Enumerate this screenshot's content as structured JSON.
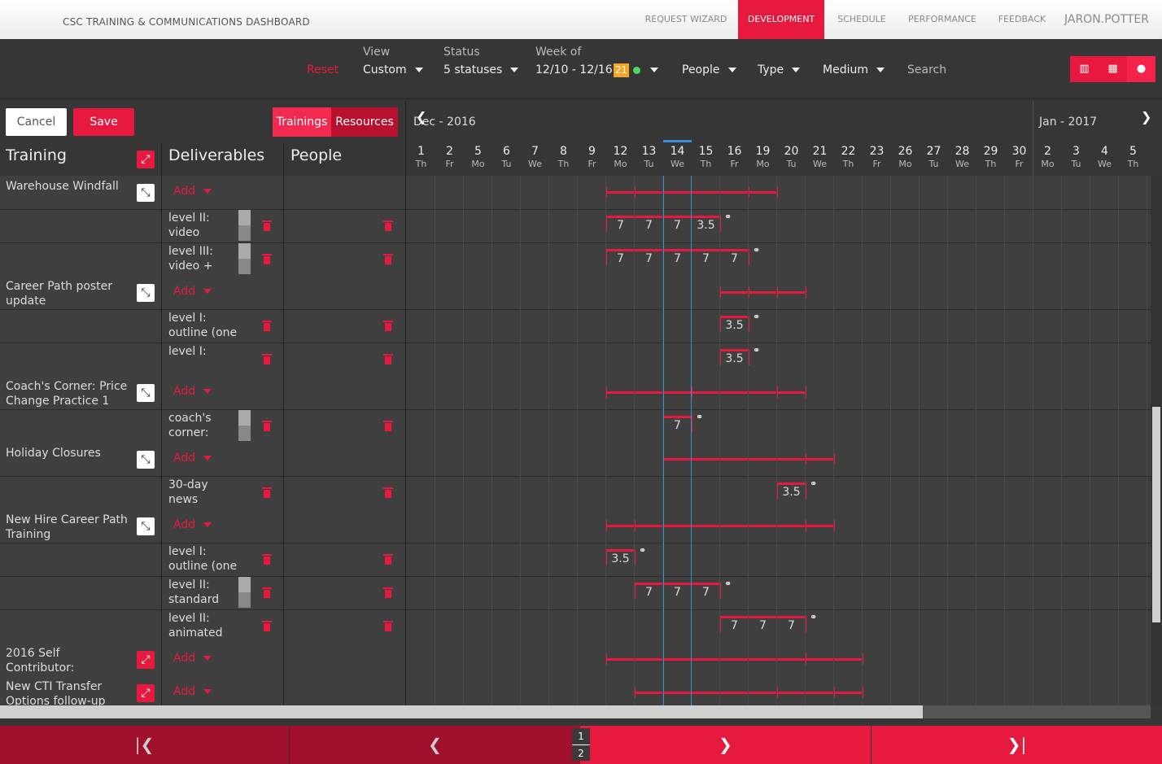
{
  "app": {
    "title": "CSC TRAINING & COMMUNICATIONS DASHBOARD"
  },
  "nav": [
    {
      "label": "REQUEST WIZARD"
    },
    {
      "label": "DEVELOPMENT"
    },
    {
      "label": "SCHEDULE"
    },
    {
      "label": "PERFORMANCE"
    },
    {
      "label": "FEEDBACK"
    }
  ],
  "user": {
    "name": "JARON.POTTER"
  },
  "filters": {
    "reset_label": "Reset",
    "view_label": "View",
    "view_value": "Custom",
    "status_label": "Status",
    "status_value": "5 statuses",
    "week_label": "Week of",
    "week_value": "12/10 - 12/16",
    "week_badge": "21",
    "people_label": "People",
    "type_label": "Type",
    "medium_label": "Medium",
    "search_label": "Search"
  },
  "toolbar": {
    "cancel_label": "Cancel",
    "save_label": "Save",
    "trainings_label": "Trainings",
    "resources_label": "Resources"
  },
  "columns": {
    "training": "Training",
    "deliverables": "Deliverables",
    "people": "People"
  },
  "calendar": {
    "month_left": "Dec - 2016",
    "month_right": "Jan - 2017",
    "days": [
      {
        "n": "1",
        "d": "Th"
      },
      {
        "n": "2",
        "d": "Fr"
      },
      {
        "n": "5",
        "d": "Mo"
      },
      {
        "n": "6",
        "d": "Tu"
      },
      {
        "n": "7",
        "d": "We"
      },
      {
        "n": "8",
        "d": "Th"
      },
      {
        "n": "9",
        "d": "Fr"
      },
      {
        "n": "12",
        "d": "Mo"
      },
      {
        "n": "13",
        "d": "Tu"
      },
      {
        "n": "14",
        "d": "We"
      },
      {
        "n": "15",
        "d": "Th"
      },
      {
        "n": "16",
        "d": "Fr"
      },
      {
        "n": "19",
        "d": "Mo"
      },
      {
        "n": "20",
        "d": "Tu"
      },
      {
        "n": "21",
        "d": "We"
      },
      {
        "n": "22",
        "d": "Th"
      },
      {
        "n": "23",
        "d": "Fr"
      },
      {
        "n": "26",
        "d": "Mo"
      },
      {
        "n": "27",
        "d": "Tu"
      },
      {
        "n": "28",
        "d": "We"
      },
      {
        "n": "29",
        "d": "Th"
      },
      {
        "n": "30",
        "d": "Fr"
      },
      {
        "n": "2",
        "d": "Mo"
      },
      {
        "n": "3",
        "d": "Tu"
      },
      {
        "n": "4",
        "d": "We"
      },
      {
        "n": "5",
        "d": "Th"
      }
    ]
  },
  "add_label": "Add",
  "trainings": [
    {
      "name": "Warehouse Windfall",
      "deliverables": [
        {
          "label": "level II: video w/bullets &",
          "values": [
            "7",
            "7",
            "7",
            "3.5"
          ]
        },
        {
          "label": "level III: video + heavily",
          "values": [
            "7",
            "7",
            "7",
            "7",
            "7"
          ]
        }
      ]
    },
    {
      "name": "Career Path poster update",
      "deliverables": [
        {
          "label": "level I: outline (one medium)",
          "values": [
            "3.5"
          ]
        },
        {
          "label": "level I:",
          "values": [
            "3.5"
          ]
        }
      ]
    },
    {
      "name": "Coach's Corner: Price Change Practice 1",
      "deliverables": [
        {
          "label": "coach's corner:",
          "values": [
            "7"
          ]
        }
      ]
    },
    {
      "name": "Holiday Closures",
      "deliverables": [
        {
          "label": "30-day news",
          "values": [
            "3.5"
          ]
        }
      ]
    },
    {
      "name": "New Hire Career Path Training",
      "deliverables": [
        {
          "label": "level I: outline (one medium)",
          "values": [
            "3.5"
          ]
        },
        {
          "label": "level II: standard",
          "values": [
            "7",
            "7",
            "7"
          ]
        },
        {
          "label": "level II: animated",
          "values": [
            "7",
            "7",
            "7"
          ]
        }
      ]
    },
    {
      "name": "2016 Self Contributor:",
      "deliverables": []
    },
    {
      "name": "New CTI Transfer Options follow-up",
      "deliverables": []
    }
  ],
  "pager": {
    "current": "1",
    "total": "2"
  },
  "colors": {
    "accent": "#e8193f",
    "today": "#3a8fd9",
    "badge": "#f5a623"
  }
}
